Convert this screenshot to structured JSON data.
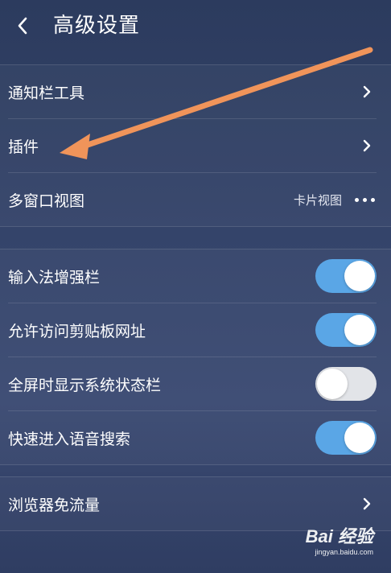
{
  "header": {
    "title": "高级设置",
    "back_icon": "chevron-left-icon"
  },
  "section_nav": {
    "items": [
      {
        "label": "通知栏工具",
        "icon": "chevron-right-icon"
      },
      {
        "label": "插件",
        "icon": "chevron-right-icon"
      },
      {
        "label": "多窗口视图",
        "value": "卡片视图",
        "icon": "more-dots-icon"
      }
    ]
  },
  "section_toggles": {
    "items": [
      {
        "label": "输入法增强栏",
        "on": true
      },
      {
        "label": "允许访问剪贴板网址",
        "on": true
      },
      {
        "label": "全屏时显示系统状态栏",
        "on": false
      },
      {
        "label": "快速进入语音搜索",
        "on": true
      }
    ]
  },
  "section_traffic": {
    "items": [
      {
        "label": "浏览器免流量",
        "icon": "chevron-right-icon"
      }
    ]
  },
  "annotation": {
    "arrow_color": "#f0945a",
    "points_to": "插件"
  },
  "watermark": {
    "brand": "Bai 经验",
    "url": "jingyan.baidu.com"
  },
  "colors": {
    "toggle_on": "#5aa6e6",
    "toggle_off": "#e2e4e8",
    "background": "#34446a"
  }
}
